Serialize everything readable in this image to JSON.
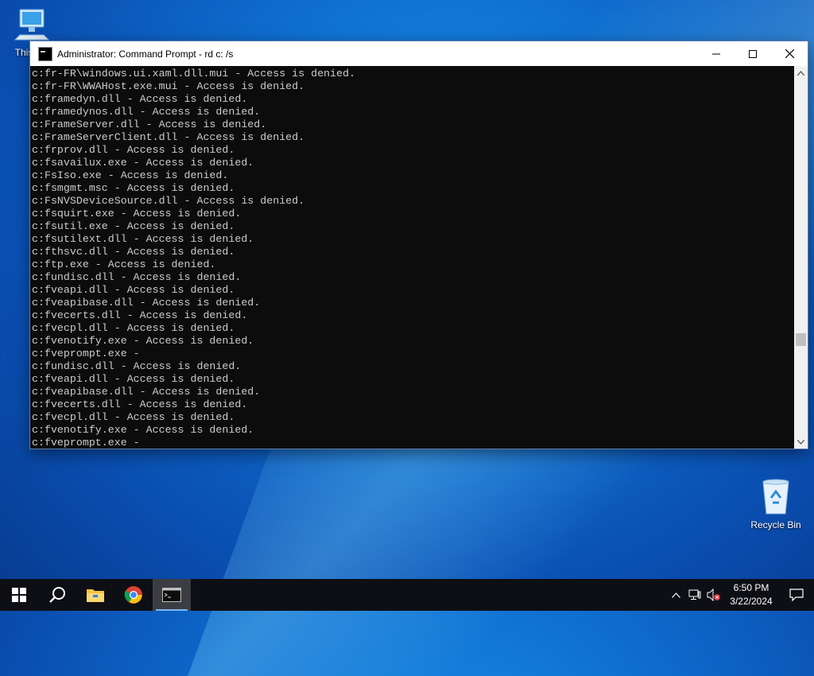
{
  "desktop": {
    "icons": [
      {
        "label": "This PC",
        "icon": "computer-icon"
      },
      {
        "label": "Recycle Bin",
        "icon": "recycle-bin-icon"
      }
    ]
  },
  "window": {
    "title": "Administrator: Command Prompt - rd  c: /s",
    "buttons": {
      "minimize": "minimize-icon",
      "maximize": "maximize-icon",
      "close": "close-icon"
    }
  },
  "console": {
    "lines": [
      "c:fr-FR\\windows.ui.xaml.dll.mui - Access is denied.",
      "c:fr-FR\\WWAHost.exe.mui - Access is denied.",
      "c:framedyn.dll - Access is denied.",
      "c:framedynos.dll - Access is denied.",
      "c:FrameServer.dll - Access is denied.",
      "c:FrameServerClient.dll - Access is denied.",
      "c:frprov.dll - Access is denied.",
      "c:fsavailux.exe - Access is denied.",
      "c:FsIso.exe - Access is denied.",
      "c:fsmgmt.msc - Access is denied.",
      "c:FsNVSDeviceSource.dll - Access is denied.",
      "c:fsquirt.exe - Access is denied.",
      "c:fsutil.exe - Access is denied.",
      "c:fsutilext.dll - Access is denied.",
      "c:fthsvc.dll - Access is denied.",
      "c:ftp.exe - Access is denied.",
      "c:fundisc.dll - Access is denied.",
      "c:fveapi.dll - Access is denied.",
      "c:fveapibase.dll - Access is denied.",
      "c:fvecerts.dll - Access is denied.",
      "c:fvecpl.dll - Access is denied.",
      "c:fvenotify.exe - Access is denied.",
      "c:fveprompt.exe - ",
      "c:fundisc.dll - Access is denied.",
      "c:fveapi.dll - Access is denied.",
      "c:fveapibase.dll - Access is denied.",
      "c:fvecerts.dll - Access is denied.",
      "c:fvecpl.dll - Access is denied.",
      "c:fvenotify.exe - Access is denied.",
      "c:fveprompt.exe - "
    ]
  },
  "taskbar": {
    "apps": [
      {
        "name": "start",
        "icon": "windows-start-icon"
      },
      {
        "name": "search",
        "icon": "search-icon"
      },
      {
        "name": "file-explorer",
        "icon": "folder-icon"
      },
      {
        "name": "chrome",
        "icon": "chrome-icon"
      },
      {
        "name": "command-prompt",
        "icon": "cmd-icon"
      }
    ],
    "clock": {
      "time": "6:50 PM",
      "date": "3/22/2024"
    }
  }
}
